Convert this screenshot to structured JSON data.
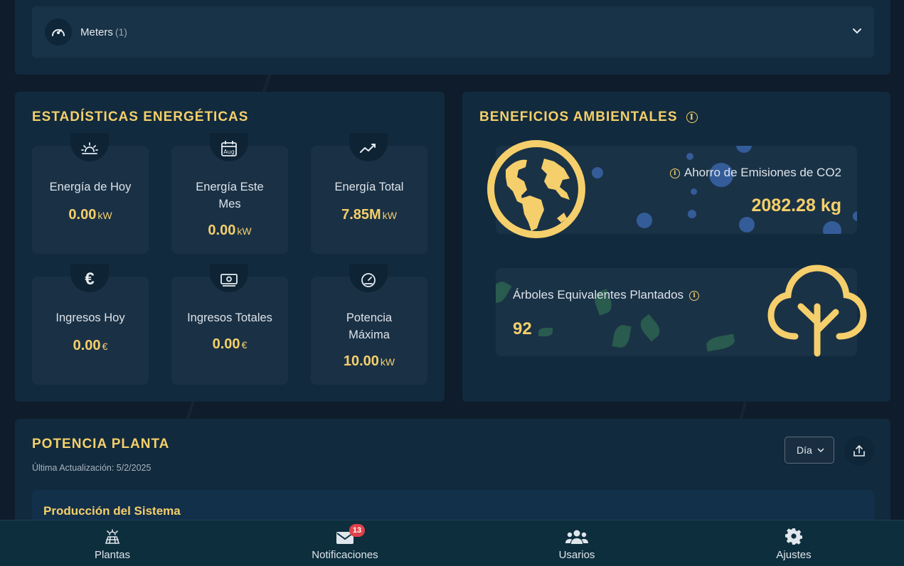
{
  "meters": {
    "label": "Meters",
    "count": "(1)"
  },
  "energy": {
    "title": "Estadísticas Energéticas",
    "stats": [
      {
        "label": "Energía de Hoy",
        "value": "0.00",
        "unit": "kW",
        "icon": "sunrise-icon"
      },
      {
        "label": "Energía Este Mes",
        "value": "0.00",
        "unit": "kW",
        "icon": "calendar-aug-icon"
      },
      {
        "label": "Energía Total",
        "value": "7.85M",
        "unit": "kW",
        "icon": "trend-line-icon"
      },
      {
        "label": "Ingresos Hoy",
        "value": "0.00",
        "unit": "€",
        "icon": "euro-icon"
      },
      {
        "label": "Ingresos Totales",
        "value": "0.00",
        "unit": "€",
        "icon": "banknote-icon"
      },
      {
        "label": "Potencia Máxima",
        "value": "10.00",
        "unit": "kW",
        "icon": "speedometer-icon"
      }
    ],
    "calendar_text": "Aug",
    "euro_symbol": "€"
  },
  "environment": {
    "title": "Beneficios Ambientales",
    "co2": {
      "label": "Ahorro de Emisiones de CO2",
      "value": "2082.28 kg"
    },
    "trees": {
      "label": "Árboles Equivalentes Plantados",
      "value": "92"
    },
    "info_glyph": "i"
  },
  "power": {
    "title": "Potencia Planta",
    "updated": "Última Actualización: 5/2/2025",
    "period": "Día",
    "production_title": "Producción del Sistema"
  },
  "nav": {
    "items": [
      {
        "label": "Plantas",
        "icon": "solar-panel-icon"
      },
      {
        "label": "Notificaciones",
        "icon": "envelope-icon",
        "badge": "13"
      },
      {
        "label": "Usarios",
        "icon": "users-icon"
      },
      {
        "label": "Ajustes",
        "icon": "gear-icon"
      }
    ]
  },
  "colors": {
    "accent": "#f5cf6b",
    "panel": "#112a3d",
    "card": "#1a3145",
    "nav": "#0d2e3d",
    "badge": "#e0424b"
  }
}
